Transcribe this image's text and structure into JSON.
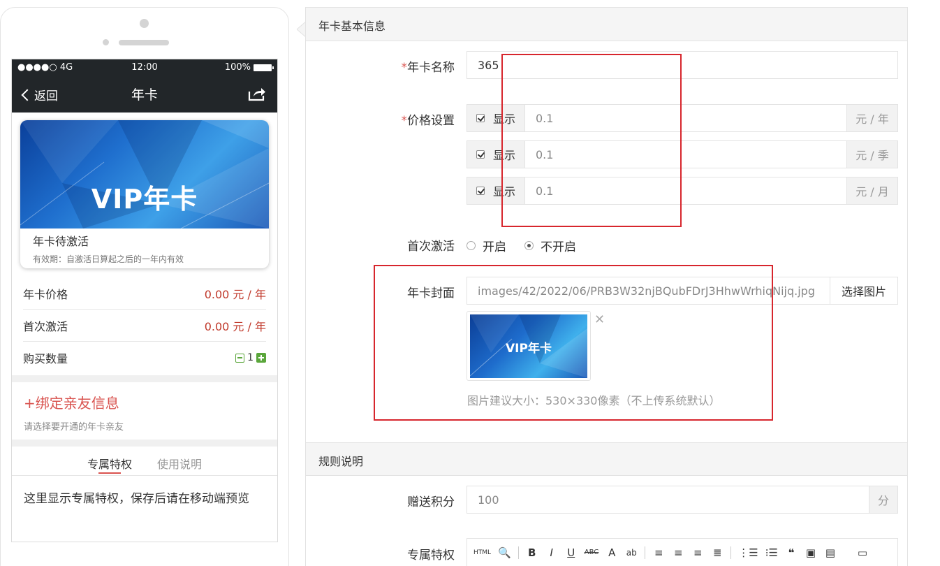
{
  "phone": {
    "status": {
      "signal": "●●●●○ 4G",
      "time": "12:00",
      "battery": "100%"
    },
    "nav": {
      "back": "返回",
      "title": "年卡"
    },
    "card": {
      "image_text": "VIP年卡",
      "status": "年卡待激活",
      "validity": "有效期：自激活日算起之后的一年内有效"
    },
    "rows": [
      {
        "label": "年卡价格",
        "value": "0.00 元 / 年"
      },
      {
        "label": "首次激活",
        "value": "0.00 元 / 年"
      },
      {
        "label": "购买数量",
        "quantity": "1"
      }
    ],
    "bind_title": "+绑定亲友信息",
    "bind_sub": "请选择要开通的年卡亲友",
    "tabs": [
      "专属特权",
      "使用说明"
    ],
    "tab_content": "这里显示专属特权，保存后请在移动端预览"
  },
  "form": {
    "section1": "年卡基本信息",
    "name_label": "年卡名称",
    "name_value": "365",
    "price_label": "价格设置",
    "price_rows": [
      {
        "check_label": "显示",
        "value": "0.1",
        "unit": "元 / 年"
      },
      {
        "check_label": "显示",
        "value": "0.1",
        "unit": "元 / 季"
      },
      {
        "check_label": "显示",
        "value": "0.1",
        "unit": "元 / 月"
      }
    ],
    "activate_label": "首次激活",
    "activate_options": [
      "开启",
      "不开启"
    ],
    "activate_selected": "不开启",
    "cover_label": "年卡封面",
    "cover_path": "images/42/2022/06/PRB3W32njBQubFDrJ3HhwWrhiqNijq.jpg",
    "cover_button": "选择图片",
    "cover_thumb_text": "VIP年卡",
    "cover_hint": "图片建议大小：530×330像素（不上传系统默认）",
    "section2": "规则说明",
    "points_label": "赠送积分",
    "points_value": "100",
    "points_unit": "分",
    "privilege_label": "专属特权",
    "editor_buttons": [
      "HTML",
      "B",
      "I",
      "U",
      "ABC",
      "A",
      "ab"
    ]
  },
  "colors": {
    "accent_red": "#d7262d",
    "price_red": "#c0392b",
    "nav_dark": "#222629",
    "stepper_green": "#5aa63b"
  }
}
